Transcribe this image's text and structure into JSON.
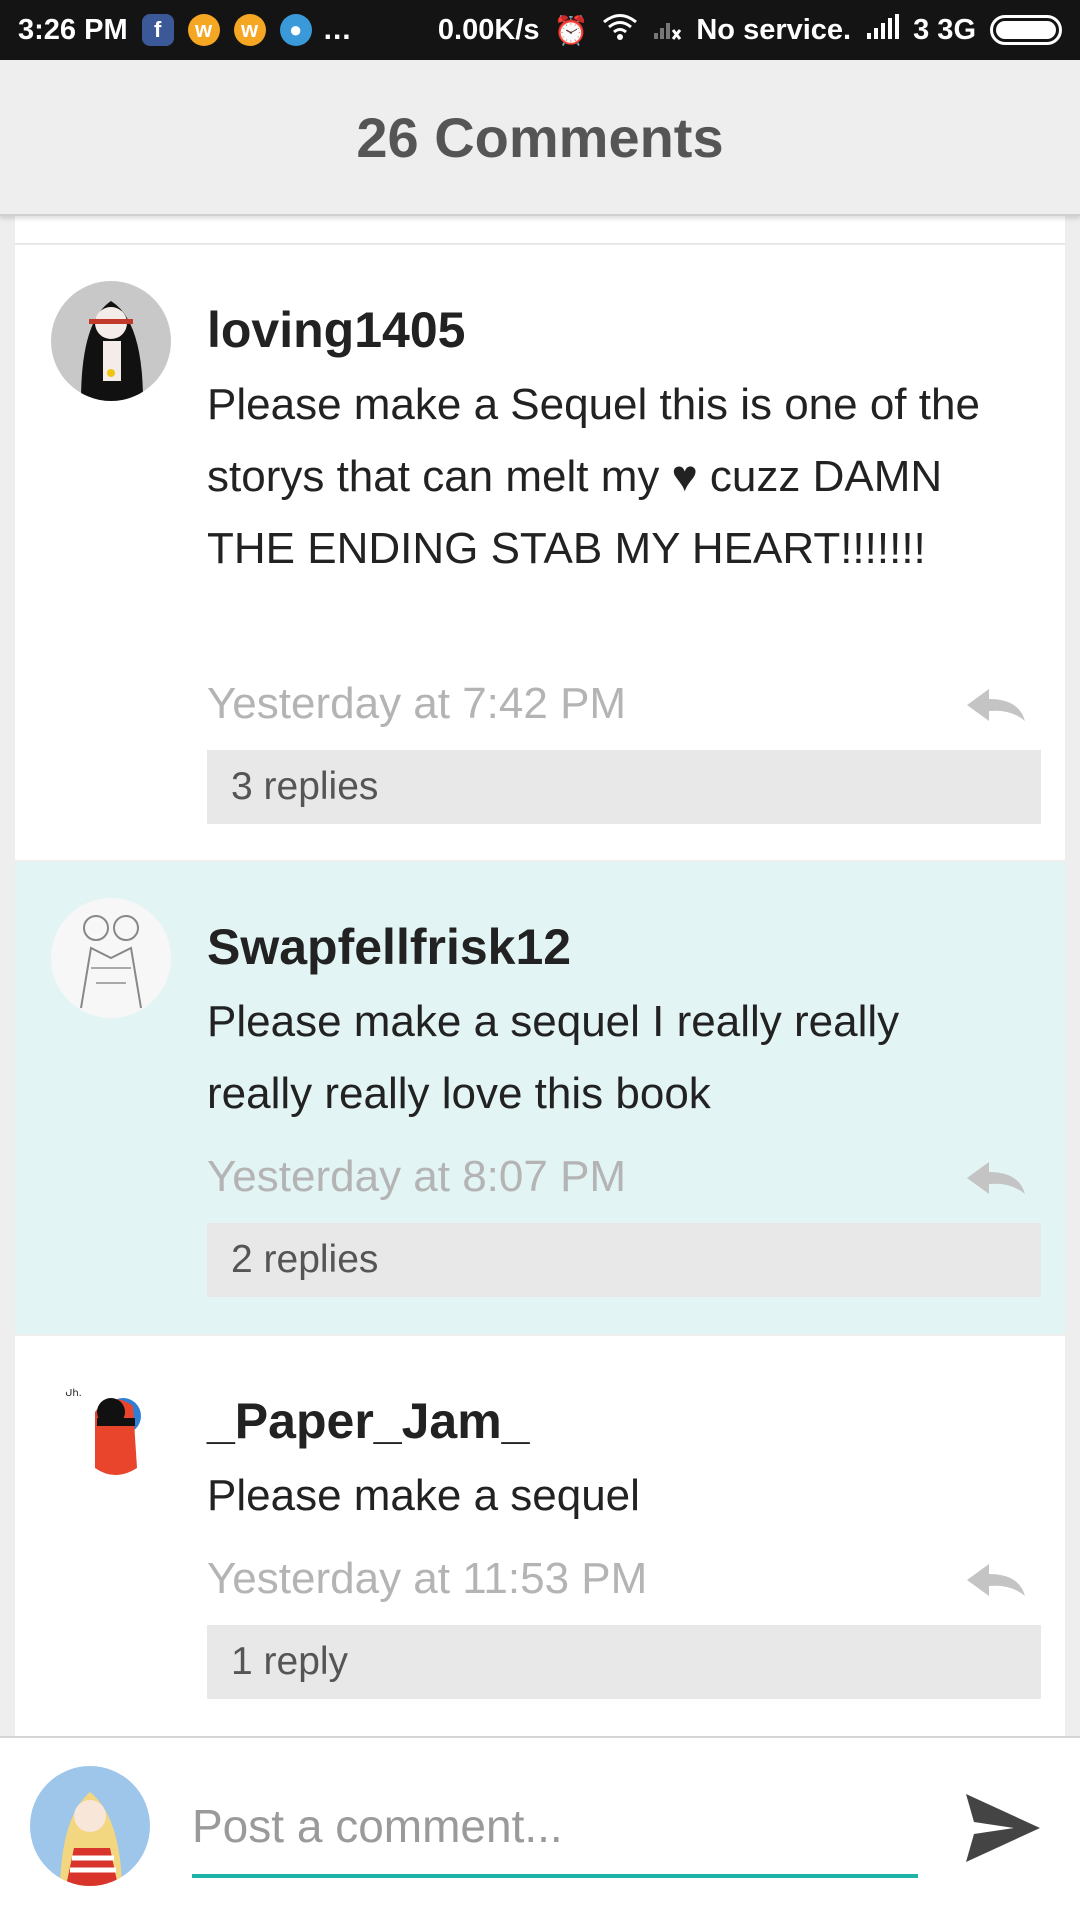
{
  "status_bar": {
    "time": "3:26 PM",
    "more_indicator": "...",
    "network_speed": "0.00K/s",
    "service_text": "No service.",
    "carrier_text": "3 3G",
    "notification_icons": [
      "facebook-icon",
      "wattpad-icon",
      "wattpad-icon",
      "messenger-icon"
    ],
    "system_icons": [
      "alarm-icon",
      "wifi-icon",
      "signal-x-icon",
      "signal-icon",
      "battery-icon"
    ]
  },
  "header": {
    "title": "26 Comments"
  },
  "comments": [
    {
      "username": "loving1405",
      "text": "Please make a Sequel this is one of the storys that can melt my ♥ cuzz DAMN THE ENDING STAB MY HEART!!!!!!!",
      "timestamp": "Yesterday at 7:42 PM",
      "replies": "3 replies"
    },
    {
      "username": "Swapfellfrisk12",
      "text": "Please make a sequel I really really really really love this book",
      "timestamp": "Yesterday at 8:07 PM",
      "replies": "2 replies"
    },
    {
      "username": "_Paper_Jam_",
      "text": "Please make a sequel",
      "timestamp": "Yesterday at 11:53 PM",
      "replies": "1 reply"
    }
  ],
  "composer": {
    "placeholder": "Post a comment..."
  },
  "colors": {
    "accent": "#1fb2a7",
    "highlight_background": "#e3f4f4",
    "header_background": "#eeeeee",
    "timestamp_text": "#b4b4b4"
  }
}
